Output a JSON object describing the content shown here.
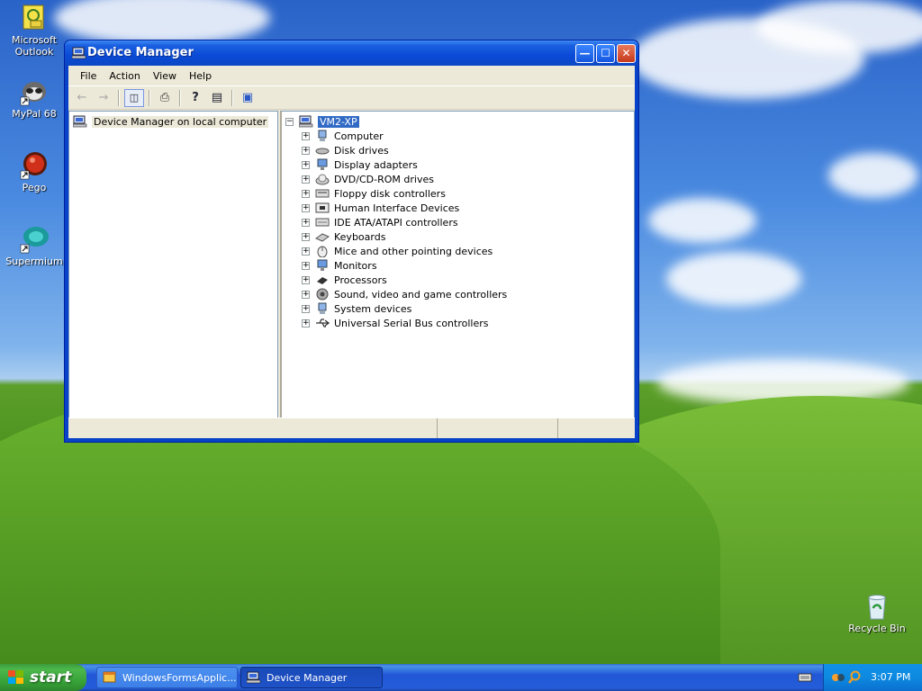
{
  "desktop": {
    "icons": [
      {
        "label": "Microsoft Outlook"
      },
      {
        "label": "MyPal 68"
      },
      {
        "label": "Pego"
      },
      {
        "label": "Supermium"
      },
      {
        "label": "Recycle Bin"
      }
    ]
  },
  "window": {
    "title": "Device Manager",
    "menu": [
      "File",
      "Action",
      "View",
      "Help"
    ],
    "left_tree_root": "Device Manager on local computer",
    "tree": {
      "root": "VM2-XP",
      "items": [
        {
          "label": "Computer",
          "icon": "computer-icon"
        },
        {
          "label": "Disk drives",
          "icon": "disk-drive-icon"
        },
        {
          "label": "Display adapters",
          "icon": "display-icon"
        },
        {
          "label": "DVD/CD-ROM drives",
          "icon": "cdrom-icon"
        },
        {
          "label": "Floppy disk controllers",
          "icon": "floppy-icon"
        },
        {
          "label": "Human Interface Devices",
          "icon": "hid-icon"
        },
        {
          "label": "IDE ATA/ATAPI controllers",
          "icon": "ide-icon"
        },
        {
          "label": "Keyboards",
          "icon": "keyboard-icon"
        },
        {
          "label": "Mice and other pointing devices",
          "icon": "mouse-icon"
        },
        {
          "label": "Monitors",
          "icon": "monitor-icon"
        },
        {
          "label": "Processors",
          "icon": "processor-icon"
        },
        {
          "label": "Sound, video and game controllers",
          "icon": "sound-icon"
        },
        {
          "label": "System devices",
          "icon": "system-icon"
        },
        {
          "label": "Universal Serial Bus controllers",
          "icon": "usb-icon"
        }
      ]
    }
  },
  "taskbar": {
    "start_label": "start",
    "tasks": [
      {
        "label": "WindowsFormsApplic..."
      },
      {
        "label": "Device Manager"
      }
    ],
    "clock": "3:07 PM"
  },
  "colors": {
    "selection": "#316ac5",
    "title_blue": "#0a4ad6",
    "start_green": "#36a036"
  }
}
